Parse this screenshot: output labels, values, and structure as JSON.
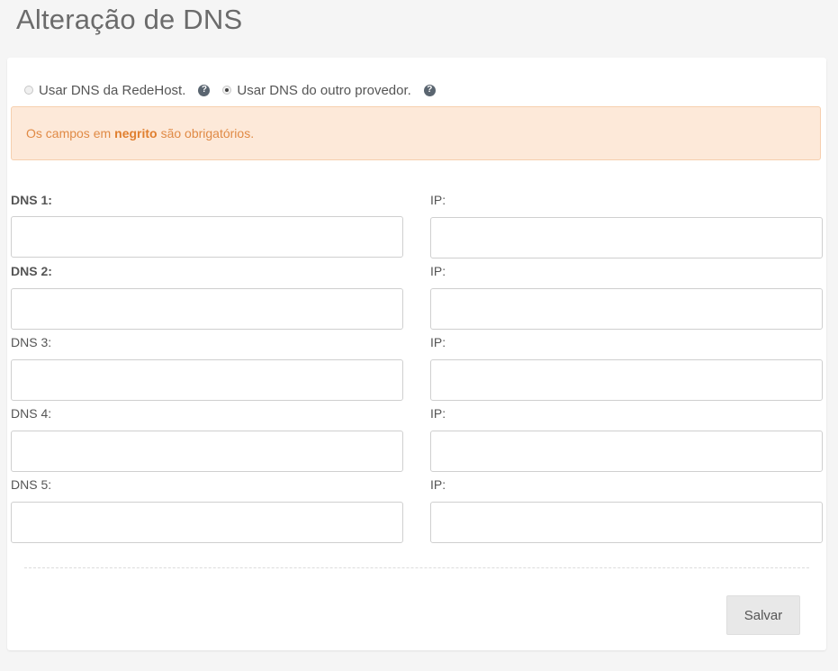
{
  "page": {
    "title": "Alteração de DNS"
  },
  "radio_options": [
    {
      "label": "Usar DNS da RedeHost.",
      "checked": false
    },
    {
      "label": "Usar DNS do outro provedor.",
      "checked": true
    }
  ],
  "alert": {
    "prefix": "Os campos em",
    "bold": "negrito",
    "suffix": "são obrigatórios.",
    "colors": {
      "background": "#fde9d9",
      "text": "#e08a45"
    }
  },
  "fields": [
    {
      "dns_label": "DNS 1:",
      "ip_label": "IP:",
      "dns_value": "",
      "ip_value": "",
      "required": true
    },
    {
      "dns_label": "DNS 2:",
      "ip_label": "IP:",
      "dns_value": "",
      "ip_value": "",
      "required": true
    },
    {
      "dns_label": "DNS 3:",
      "ip_label": "IP:",
      "dns_value": "",
      "ip_value": "",
      "required": false
    },
    {
      "dns_label": "DNS 4:",
      "ip_label": "IP:",
      "dns_value": "",
      "ip_value": "",
      "required": false
    },
    {
      "dns_label": "DNS 5:",
      "ip_label": "IP:",
      "dns_value": "",
      "ip_value": "",
      "required": false
    }
  ],
  "actions": {
    "save_label": "Salvar"
  },
  "icons": {
    "help": "question-circle-icon"
  }
}
